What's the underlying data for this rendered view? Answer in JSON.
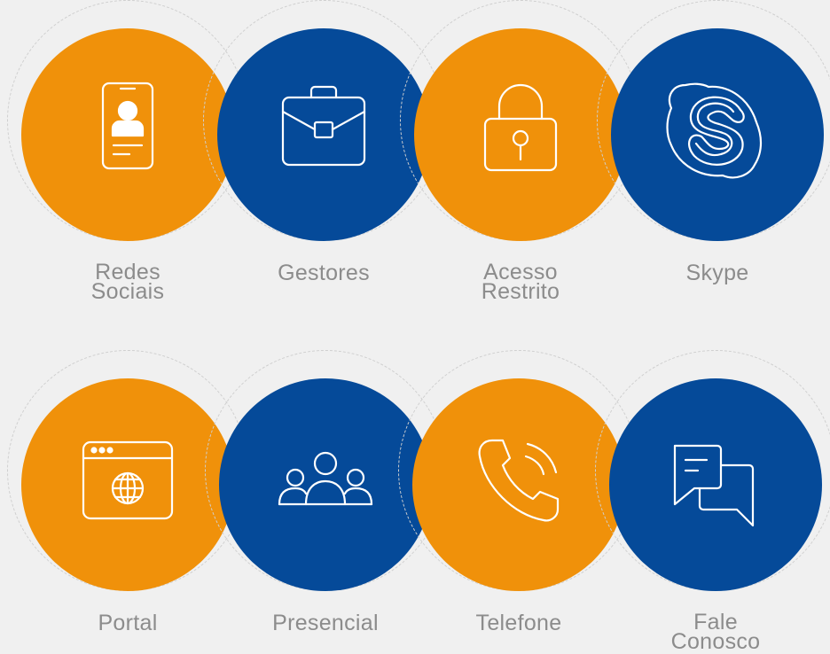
{
  "colors": {
    "background": "#f0f0f0",
    "orange": "#f0910a",
    "blue": "#054a99",
    "label": "#8c8c8c",
    "icon_stroke": "#ffffff"
  },
  "row1": [
    {
      "label": "Redes\nSociais",
      "color": "orange",
      "icon": "mobile-profile-icon"
    },
    {
      "label": "Gestores",
      "color": "blue",
      "icon": "briefcase-icon"
    },
    {
      "label": "Acesso\nRestrito",
      "color": "orange",
      "icon": "padlock-icon"
    },
    {
      "label": "Skype",
      "color": "blue",
      "icon": "skype-icon"
    }
  ],
  "row2": [
    {
      "label": "Portal",
      "color": "orange",
      "icon": "browser-globe-icon"
    },
    {
      "label": "Presencial",
      "color": "blue",
      "icon": "people-group-icon"
    },
    {
      "label": "Telefone",
      "color": "orange",
      "icon": "phone-call-icon"
    },
    {
      "label": "Fale\nConosco",
      "color": "blue",
      "icon": "chat-bubbles-icon"
    }
  ]
}
